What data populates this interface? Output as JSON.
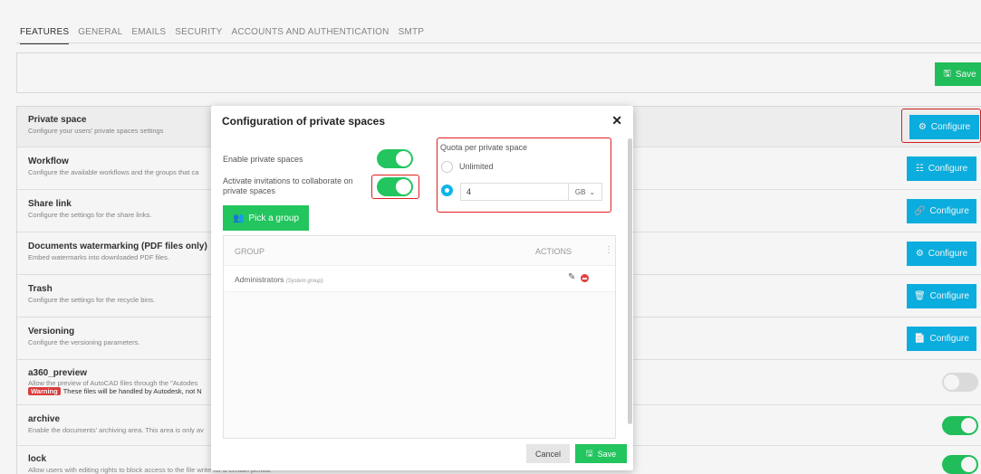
{
  "tabs": [
    "FEATURES",
    "GENERAL",
    "EMAILS",
    "SECURITY",
    "ACCOUNTS AND AUTHENTICATION",
    "SMTP"
  ],
  "top_save": "Save",
  "rows": [
    {
      "title": "Private space",
      "desc": "Configure your users' private spaces settings",
      "button": "Configure"
    },
    {
      "title": "Workflow",
      "desc": "Configure the available workflows and the groups that ca",
      "button": "Configure"
    },
    {
      "title": "Share link",
      "desc": "Configure the settings for the share links.",
      "button": "Configure"
    },
    {
      "title": "Documents watermarking (PDF files only)",
      "desc": "Embed watermarks into downloaded PDF files.",
      "button": "Configure"
    },
    {
      "title": "Trash",
      "desc": "Configure the settings for the recycle bins.",
      "button": "Configure"
    },
    {
      "title": "Versioning",
      "desc": "Configure the versioning parameters.",
      "button": "Configure"
    },
    {
      "title": "a360_preview",
      "desc": "Allow the preview of AutoCAD files through the \"Autodes",
      "warning": "Warning",
      "warning_text": "These files will be handled by Autodesk, not N",
      "toggle": false
    },
    {
      "title": "archive",
      "desc": "Enable the documents' archiving area. This area is only av",
      "toggle": true
    },
    {
      "title": "lock",
      "desc": "Allow users with editing rights to block access to the file write for a certain period.",
      "toggle": true
    }
  ],
  "modal": {
    "title": "Configuration of private spaces",
    "enable_label": "Enable private spaces",
    "invite_label": "Activate invitations to collaborate on private spaces",
    "pick_group": "Pick a group",
    "quota_label": "Quota per private space",
    "unlimited": "Unlimited",
    "quota_value": "4",
    "unit": "GB",
    "col_group": "GROUP",
    "col_actions": "ACTIONS",
    "group_name": "Administrators",
    "group_tag": "(System group)",
    "cancel": "Cancel",
    "save": "Save"
  },
  "colors": {
    "accent_blue": "#0bb5e8",
    "accent_green": "#22c55e",
    "highlight_red": "#e02020"
  }
}
